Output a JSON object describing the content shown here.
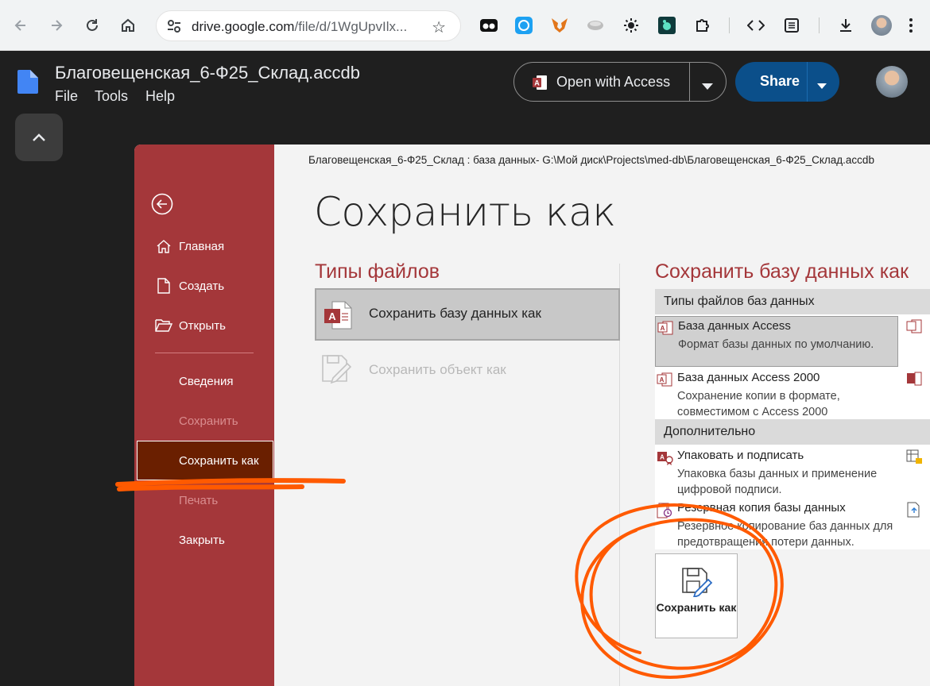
{
  "browser": {
    "url_main": "drive.google.com",
    "url_rest": "/file/d/1WgUpvIlx...",
    "icons": [
      "back-icon",
      "forward-icon",
      "reload-icon",
      "home-icon",
      "site-settings-icon",
      "bookmark-star-icon",
      "extension-icons",
      "download-icon",
      "profile-avatar",
      "menu-icon"
    ]
  },
  "drive": {
    "file_title": "Благовещенская_6-Ф25_Склад.accdb",
    "menu": [
      "File",
      "Tools",
      "Help"
    ],
    "open_with_label": "Open with Access",
    "share_label": "Share"
  },
  "access": {
    "path": "Благовещенская_6-Ф25_Склад : база данных- G:\\Мой диск\\Projects\\med-db\\Благовещенская_6-Ф25_Склад.accdb",
    "page_title": "Сохранить как",
    "backstage": {
      "home": "Главная",
      "create": "Создать",
      "open": "Открыть",
      "info": "Сведения",
      "save": "Сохранить",
      "save_as": "Сохранить как",
      "print": "Печать",
      "close": "Закрыть"
    },
    "file_types_heading": "Типы файлов",
    "save_db_as_option": "Сохранить базу данных как",
    "save_object_as_option": "Сохранить объект как",
    "save_db_as_heading": "Сохранить базу данных как",
    "db_file_types_header": "Типы файлов баз данных",
    "access_db_title": "База данных Access",
    "access_db_desc": "Формат базы данных по умолчанию.",
    "access2000_title": "База данных Access 2000",
    "access2000_desc": "Сохранение копии в формате, совместимом с Access 2000",
    "advanced_header": "Дополнительно",
    "package_title": "Упаковать и подписать",
    "package_desc": "Упаковка базы данных и применение цифровой подписи.",
    "backup_title": "Резервная копия базы данных",
    "backup_desc": "Резервное копирование баз данных для предотвращения потери данных.",
    "save_as_button": "Сохранить как"
  },
  "colors": {
    "backstage_red": "#a4373a",
    "selected_item": "#6a1f00",
    "annotation_orange": "#ff5a00",
    "share_blue": "#0b4f8a"
  }
}
